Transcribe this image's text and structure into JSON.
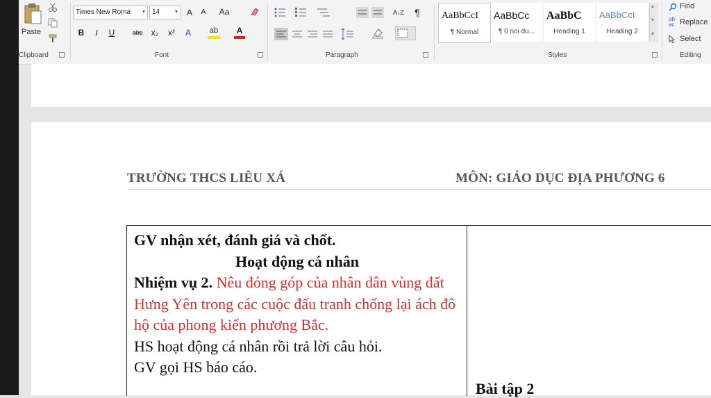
{
  "ribbon": {
    "clipboard": {
      "paste_label": "Paste",
      "group_label": "Clipboard"
    },
    "font": {
      "font_name": "Times New Roma",
      "font_size": "14",
      "grow": "A",
      "shrink": "A",
      "case": "Aa",
      "bold": "B",
      "italic": "I",
      "underline": "U",
      "strike": "abc",
      "subscript": "x₂",
      "superscript": "x²",
      "effects": "A",
      "highlight": "ab",
      "color": "A",
      "group_label": "Font"
    },
    "paragraph": {
      "sort": "A↓Z",
      "pilcrow": "¶",
      "group_label": "Paragraph"
    },
    "styles": {
      "items": [
        {
          "sample": "AaBbCcI",
          "name": "¶ Normal"
        },
        {
          "sample": "AaBbCc",
          "name": "¶ 0 noi du..."
        },
        {
          "sample": "AaBbC",
          "name": "Heading 1"
        },
        {
          "sample": "AaBbCcI",
          "name": "Heading 2"
        }
      ],
      "group_label": "Styles"
    },
    "editing": {
      "find": "Find",
      "replace": "Replace",
      "select": "Select",
      "group_label": "Editing"
    }
  },
  "document": {
    "header_left": "TRƯỜNG THCS LIÊU XÁ",
    "header_right": "MÔN: GIÁO DỤC ĐỊA PHƯƠNG 6",
    "cell": {
      "line1": "GV nhận xét, đánh giá và chốt.",
      "line2": "Hoạt động cá nhân",
      "task_label": "Nhiệm vụ 2.",
      "task_text": "Nêu đóng góp của nhân dân vùng đất Hưng Yên trong các cuộc đấu tranh chống lại ách đô hộ của phong kiến phương Bắc.",
      "line_hs": "HS hoạt động cá nhân rồi trả lời câu hỏi.",
      "line_gv": "GV gọi HS báo cáo."
    },
    "right_cell_label": "Bài tập 2"
  },
  "colors": {
    "task_red": "#d2322d",
    "ribbon_bg": "#f3f3f3"
  }
}
